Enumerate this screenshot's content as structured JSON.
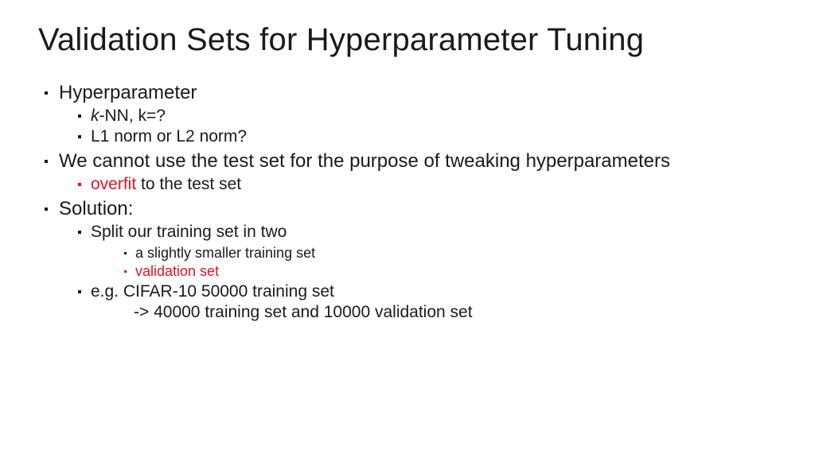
{
  "title": "Validation Sets for Hyperparameter Tuning",
  "bullets": {
    "b1": "Hyperparameter",
    "b1_1_prefix": "k",
    "b1_1_rest": "-NN, k=?",
    "b1_2": "L1 norm or L2 norm?",
    "b2": "We cannot use the test set for the purpose of tweaking hyperparameters",
    "b2_1_red": "overfit",
    "b2_1_rest": " to the test set",
    "b3": "Solution:",
    "b3_1": "Split our training set in two",
    "b3_1_1": "a slightly smaller training set",
    "b3_1_2": "validation set",
    "b3_2": "e.g. CIFAR-10 50000 training set",
    "b3_2_cont": "-> 40000 training set and 10000 validation set"
  }
}
